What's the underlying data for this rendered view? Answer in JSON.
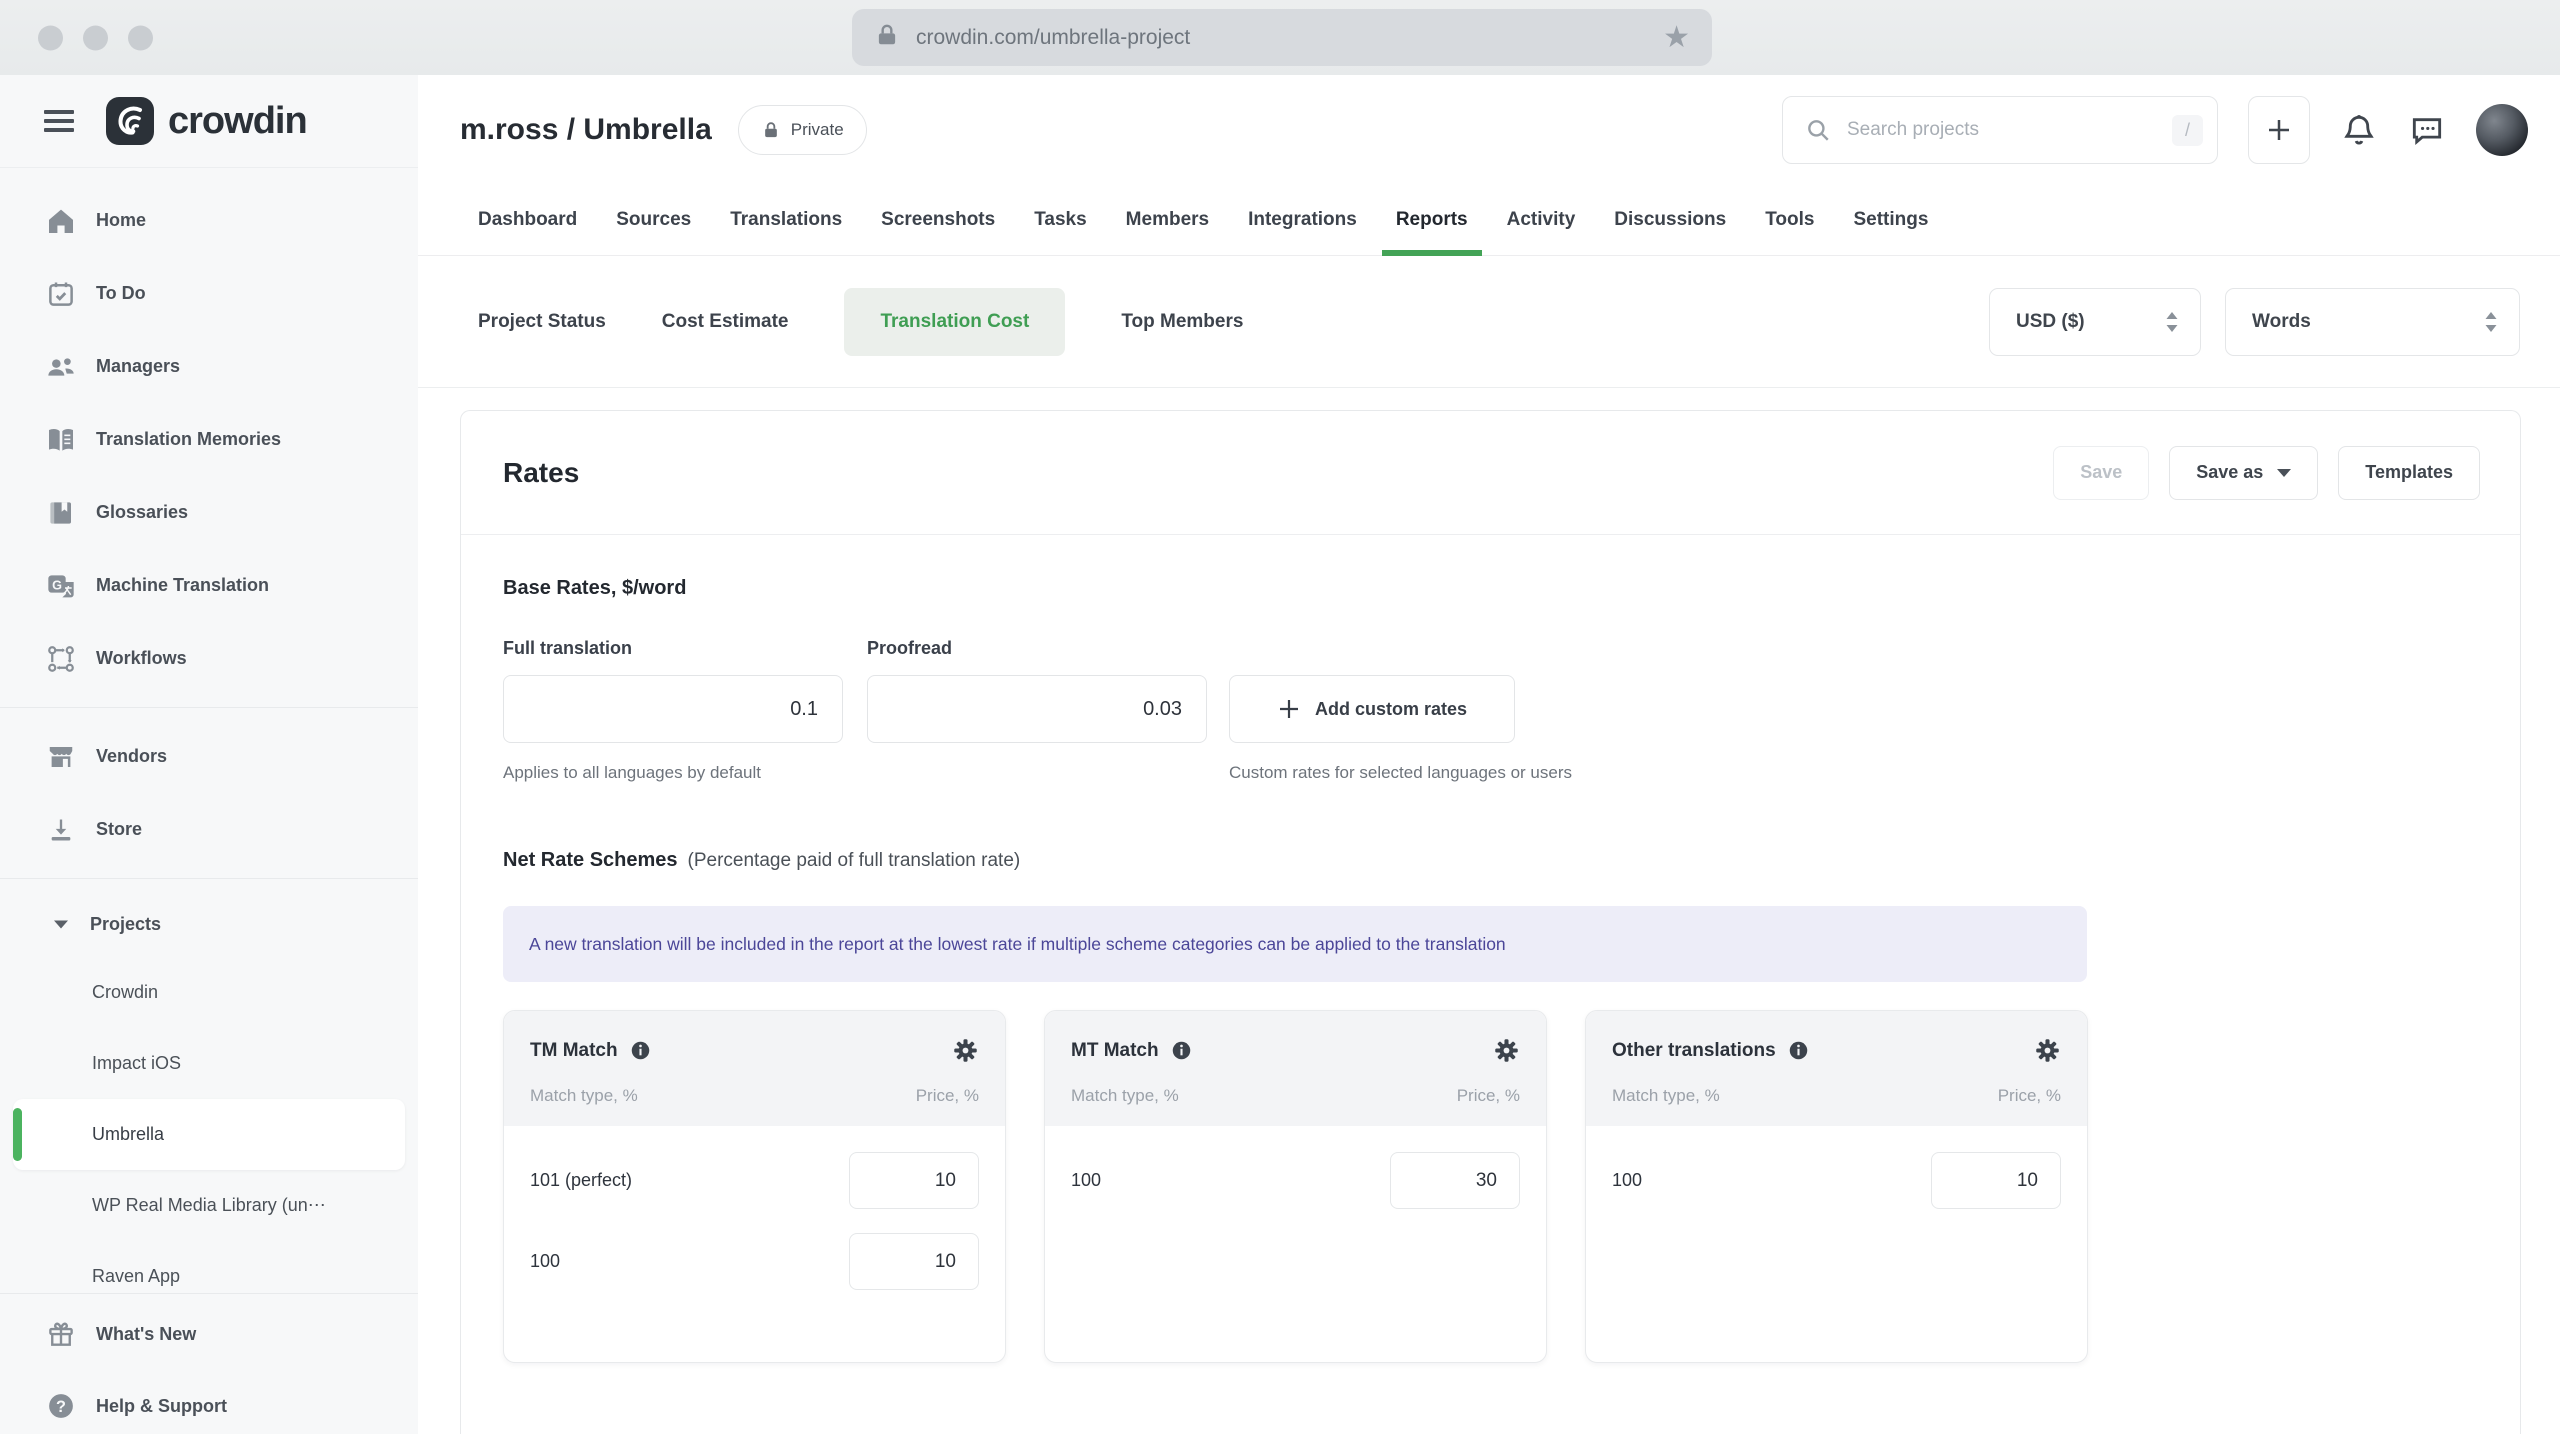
{
  "browser": {
    "url": "crowdin.com/umbrella-project"
  },
  "brand": {
    "name": "crowdin"
  },
  "topbar": {
    "search_placeholder": "Search projects",
    "search_shortcut": "/"
  },
  "sidebar": {
    "items": [
      {
        "label": "Home"
      },
      {
        "label": "To Do"
      },
      {
        "label": "Managers"
      },
      {
        "label": "Translation Memories"
      },
      {
        "label": "Glossaries"
      },
      {
        "label": "Machine Translation"
      },
      {
        "label": "Workflows"
      }
    ],
    "secondary": [
      {
        "label": "Vendors"
      },
      {
        "label": "Store"
      }
    ],
    "projects_group": {
      "label": "Projects",
      "children": [
        {
          "label": "Crowdin"
        },
        {
          "label": "Impact iOS"
        },
        {
          "label": "Umbrella",
          "selected": true
        },
        {
          "label": "WP Real Media Library (un⋯"
        },
        {
          "label": "Raven App"
        }
      ]
    },
    "footer": [
      {
        "label": "What's New"
      },
      {
        "label": "Help & Support"
      }
    ]
  },
  "header": {
    "project_path": "m.ross / Umbrella",
    "privacy_badge": "Private"
  },
  "tabs": {
    "items": [
      "Dashboard",
      "Sources",
      "Translations",
      "Screenshots",
      "Tasks",
      "Members",
      "Integrations",
      "Reports",
      "Activity",
      "Discussions",
      "Tools",
      "Settings"
    ],
    "active": "Reports"
  },
  "report_nav": {
    "items": [
      "Project Status",
      "Cost Estimate",
      "Translation Cost",
      "Top Members"
    ],
    "active": "Translation Cost",
    "currency_select": "USD ($)",
    "units_select": "Words"
  },
  "rates": {
    "title": "Rates",
    "save_label": "Save",
    "save_as_label": "Save as",
    "templates_label": "Templates"
  },
  "base_rates": {
    "title": "Base Rates, $/word",
    "full_translation_label": "Full translation",
    "full_translation_value": "0.1",
    "proofread_label": "Proofread",
    "proofread_value": "0.03",
    "add_custom_label": "Add custom rates",
    "full_translation_help": "Applies to all languages by default",
    "custom_help": "Custom rates for selected languages or users"
  },
  "net_rate_schemes": {
    "title": "Net Rate Schemes",
    "subtitle": "(Percentage paid of full translation rate)",
    "banner": "A new translation will be included in the report at the lowest rate if multiple scheme categories can be applied to the translation",
    "columns": {
      "match": "Match type, %",
      "price": "Price, %"
    },
    "cards": [
      {
        "title": "TM Match",
        "rows": [
          {
            "match": "101 (perfect)",
            "price": "10"
          },
          {
            "match": "100",
            "price": "10"
          }
        ]
      },
      {
        "title": "MT Match",
        "rows": [
          {
            "match": "100",
            "price": "30"
          }
        ]
      },
      {
        "title": "Other translations",
        "rows": [
          {
            "match": "100",
            "price": "10"
          }
        ]
      }
    ]
  },
  "colors": {
    "accent_green": "#43a356",
    "selected_bar_green": "#4bb35f",
    "banner_bg": "#ededf8",
    "banner_text": "#4b4698"
  }
}
